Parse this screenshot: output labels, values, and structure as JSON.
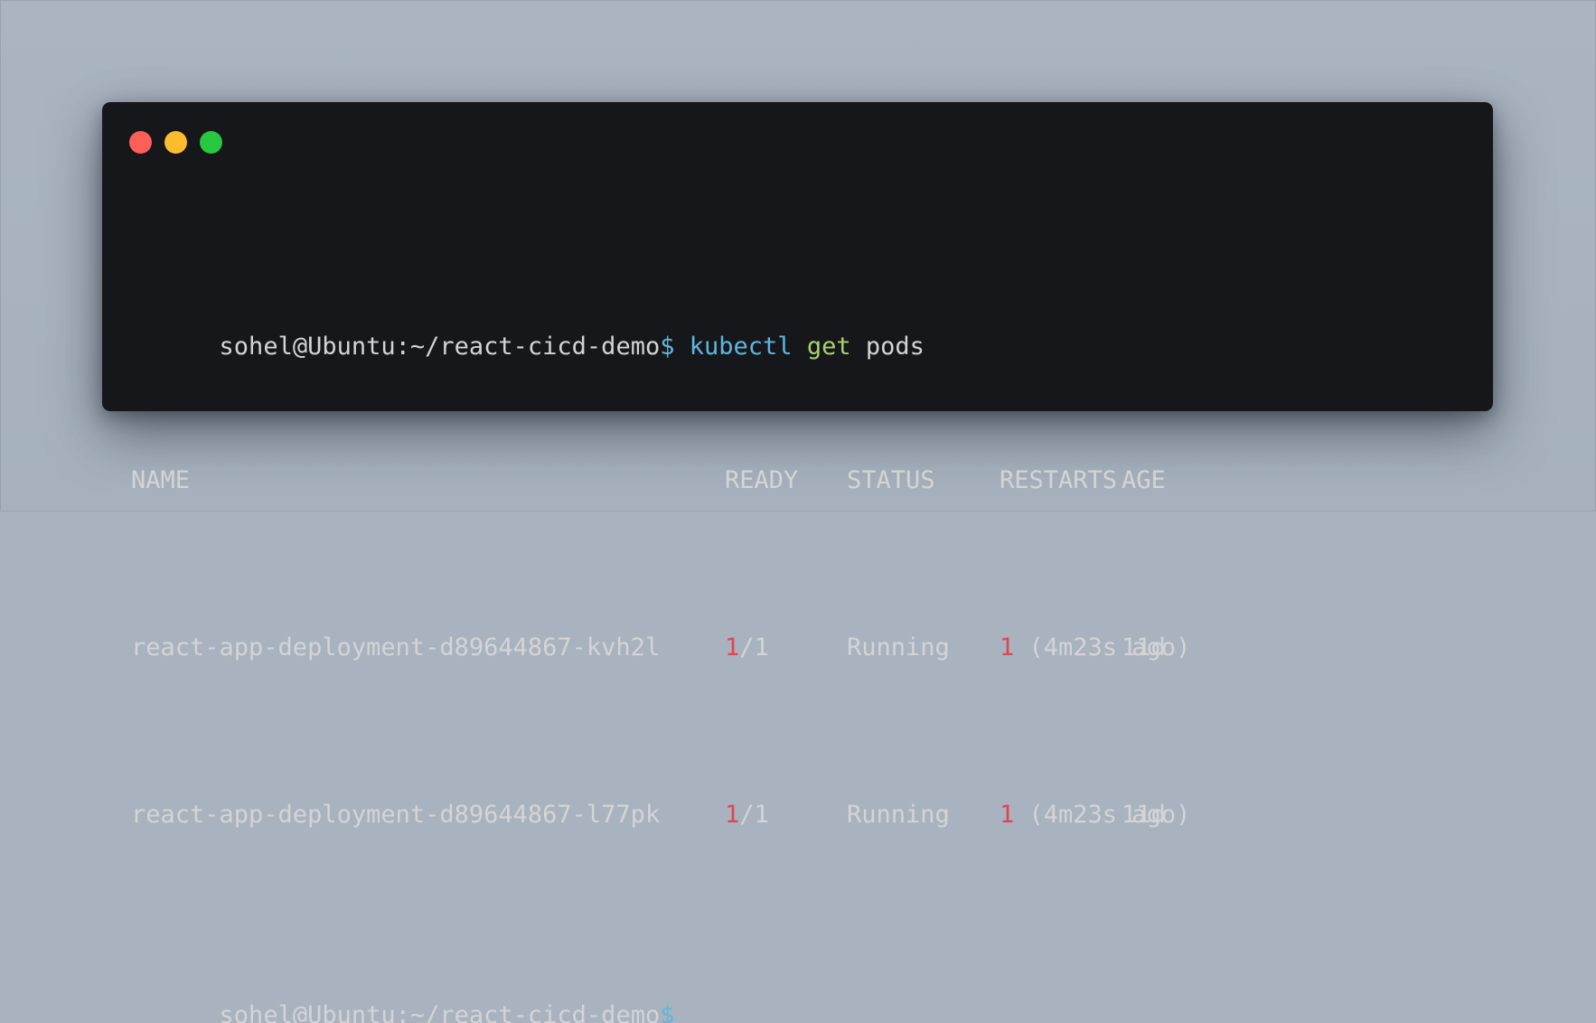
{
  "colors": {
    "background": "#a8b3bf",
    "terminal_bg": "#16171a",
    "text": "#d4d4d6",
    "command": "#5cb8e0",
    "subcommand": "#a8d16a",
    "highlight_number": "#e0454f",
    "light_close": "#fe5f57",
    "light_minimize": "#febc2e",
    "light_maximize": "#28c840"
  },
  "window": {
    "lights": [
      "close-light",
      "minimize-light",
      "maximize-light"
    ]
  },
  "prompt": {
    "user_host_path": "sohel@Ubuntu:~/react-cicd-demo",
    "symbol": "$"
  },
  "command": {
    "program": "kubectl",
    "verb": "get",
    "resource": "pods"
  },
  "table": {
    "headers": [
      "NAME",
      "READY",
      "STATUS",
      "RESTARTS",
      "AGE"
    ],
    "rows": [
      {
        "name": "react-app-deployment-d89644867-kvh2l",
        "ready_num": "1",
        "ready_rest": "/1",
        "status": "Running",
        "restarts_num": "1",
        "restarts_rest": " (4m23s ago)",
        "age": "11d"
      },
      {
        "name": "react-app-deployment-d89644867-l77pk",
        "ready_num": "1",
        "ready_rest": "/1",
        "status": "Running",
        "restarts_num": "1",
        "restarts_rest": " (4m23s ago)",
        "age": "11d"
      }
    ]
  }
}
